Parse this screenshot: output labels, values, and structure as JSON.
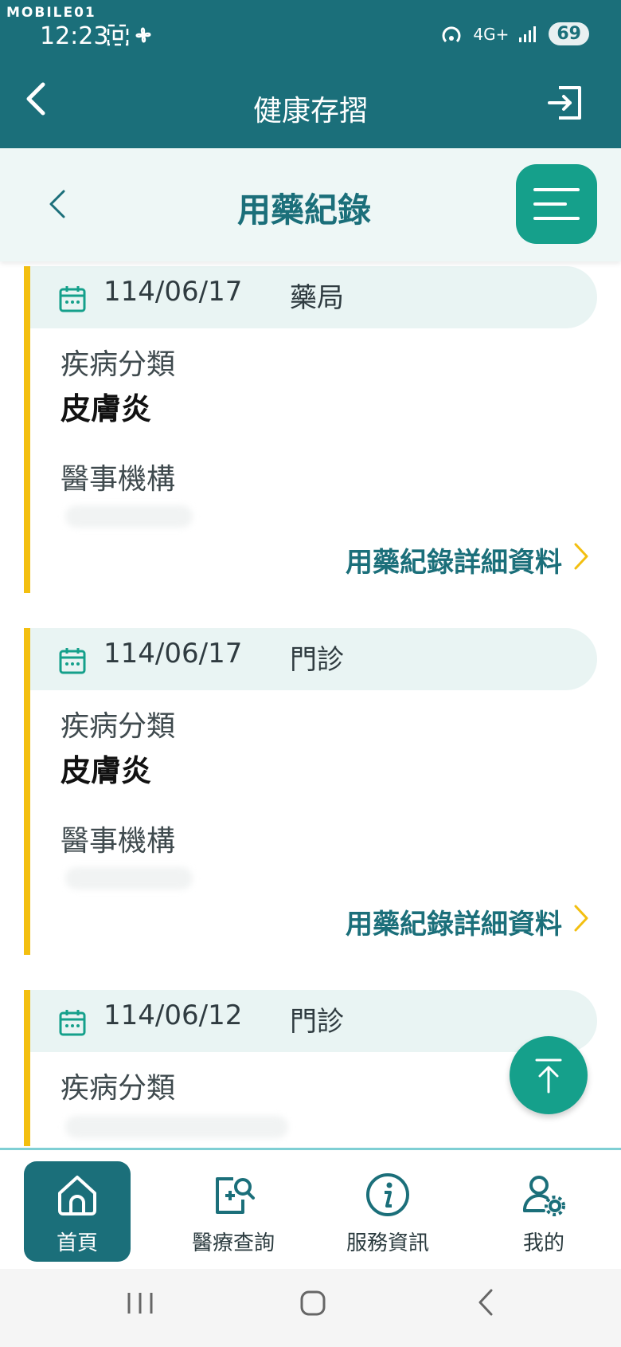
{
  "status_bar": {
    "watermark": "MOBILE01",
    "time": "12:23",
    "network": "4G+",
    "battery": "69"
  },
  "app_bar": {
    "title": "健康存摺"
  },
  "sub_header": {
    "title": "用藥紀錄"
  },
  "records": [
    {
      "date": "114/06/17",
      "type": "藥局",
      "disease_label": "疾病分類",
      "disease": "皮膚炎",
      "institution_label": "醫事機構",
      "detail_link": "用藥紀錄詳細資料"
    },
    {
      "date": "114/06/17",
      "type": "門診",
      "disease_label": "疾病分類",
      "disease": "皮膚炎",
      "institution_label": "醫事機構",
      "detail_link": "用藥紀錄詳細資料"
    },
    {
      "date": "114/06/12",
      "type": "門診",
      "disease_label": "疾病分類"
    }
  ],
  "bottom_nav": {
    "items": [
      {
        "label": "首頁",
        "icon": "home-icon",
        "active": true
      },
      {
        "label": "醫療查詢",
        "icon": "medical-search-icon"
      },
      {
        "label": "服務資訊",
        "icon": "info-icon"
      },
      {
        "label": "我的",
        "icon": "user-settings-icon"
      }
    ]
  },
  "colors": {
    "primary": "#1b6f7a",
    "accent": "#15a08b",
    "highlight": "#f3bf10",
    "subheader_bg": "#eef7f6"
  }
}
